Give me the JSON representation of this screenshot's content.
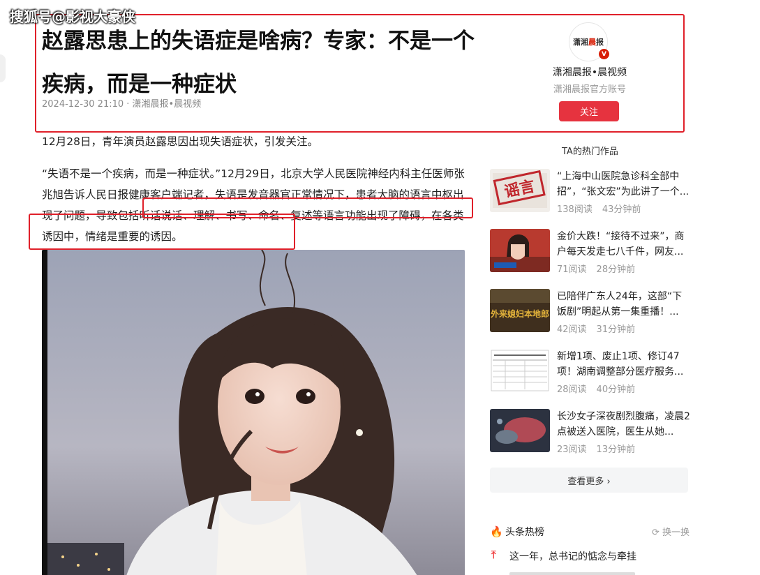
{
  "watermark": "搜狐号@影视大豪侠",
  "article": {
    "title": "赵露思患上的失语症是啥病？专家：不是一个疾病，而是一种症状",
    "meta": "2024-12-30 21:10 · 潇湘晨报•晨视频",
    "paragraphs": [
      "12月28日，青年演员赵露思因出现失语症状，引发关注。",
      "“失语不是一个疾病，而是一种症状。”12月29日，北京大学人民医院神经内科主任医师张兆旭告诉人民日报健康客户端记者，失语是发音器官正常情况下，患者大脑的语言中枢出现了问题，导致包括听话说话、理解、书写、命名、复述等语言功能出现了障碍，在各类诱因中，情绪是重要的诱因。"
    ]
  },
  "author": {
    "logo_text_a": "潇湘",
    "logo_text_b": "晨",
    "logo_text_c": "报",
    "badge": "V",
    "name": "潇湘晨报•晨视频",
    "desc": "潇湘晨报官方账号",
    "follow_label": "关注"
  },
  "sidebar": {
    "section_title": "TA的热门作品",
    "items": [
      {
        "title": "“上海中山医院急诊科全部中招”，“张文宏”为此讲了一个...",
        "reads": "138阅读",
        "time": "43分钟前",
        "thumb_text": "谣言"
      },
      {
        "title": "金价大跌！“接待不过来”，商户每天发走七八千件，网友...",
        "reads": "71阅读",
        "time": "28分钟前",
        "thumb_text": ""
      },
      {
        "title": "已陪伴广东人24年，这部“下饭剧”明起从第一集重播！...",
        "reads": "42阅读",
        "time": "31分钟前",
        "thumb_text": "外来媳妇本地郎"
      },
      {
        "title": "新增1项、废止1项、修订47项！湖南调整部分医疗服务...",
        "reads": "28阅读",
        "time": "40分钟前",
        "thumb_text": ""
      },
      {
        "title": "长沙女子深夜剧烈腹痛，凌晨2点被送入医院，医生从她...",
        "reads": "23阅读",
        "time": "13分钟前",
        "thumb_text": ""
      }
    ],
    "more_label": "查看更多 ›"
  },
  "hot": {
    "label": "头条热榜",
    "refresh_label": "换一换",
    "first_item": "这一年，总书记的惦念与牵挂"
  }
}
